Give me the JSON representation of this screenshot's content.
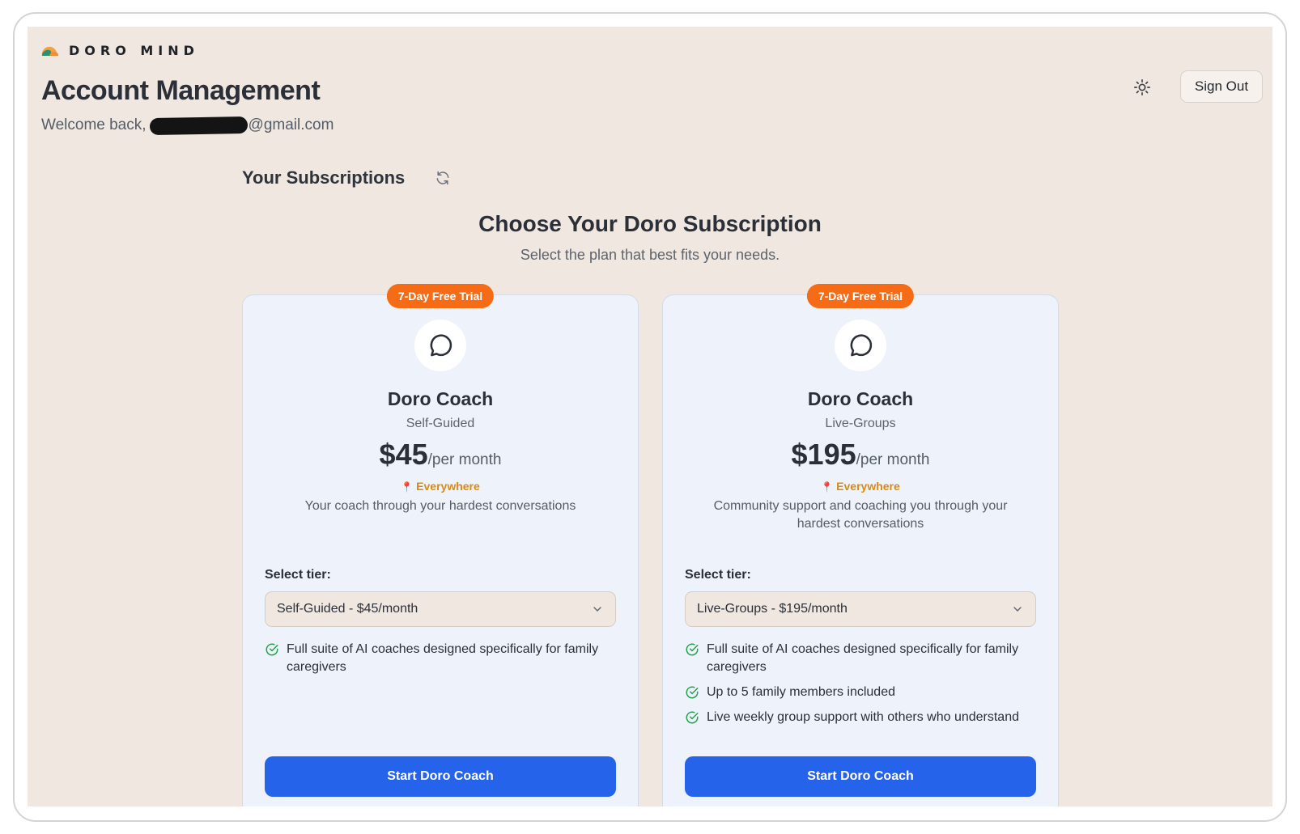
{
  "brand": {
    "logo_text": "DORO MIND"
  },
  "header": {
    "title": "Account Management",
    "welcome_prefix": "Welcome back, ",
    "email_suffix": "@gmail.com",
    "sign_out_label": "Sign Out"
  },
  "subscriptions": {
    "heading": "Your Subscriptions",
    "choose_title": "Choose Your Doro Subscription",
    "choose_subtitle": "Select the plan that best fits your needs."
  },
  "plans": [
    {
      "badge": "7-Day Free Trial",
      "name": "Doro Coach",
      "tier": "Self-Guided",
      "price": "$45",
      "period": "/per month",
      "location": "Everywhere",
      "description": "Your coach through your hardest conversations",
      "select_label": "Select tier:",
      "selected_option": "Self-Guided - $45/month",
      "features": [
        "Full suite of AI coaches designed specifically for family caregivers"
      ],
      "cta": "Start Doro Coach"
    },
    {
      "badge": "7-Day Free Trial",
      "name": "Doro Coach",
      "tier": "Live-Groups",
      "price": "$195",
      "period": "/per month",
      "location": "Everywhere",
      "description": "Community support and coaching you through your hardest conversations",
      "select_label": "Select tier:",
      "selected_option": "Live-Groups - $195/month",
      "features": [
        "Full suite of AI coaches designed specifically for family caregivers",
        "Up to 5 family members included",
        "Live weekly group support with others who understand"
      ],
      "cta": "Start Doro Coach"
    }
  ],
  "icons": {
    "logo": "doro-logo-icon",
    "theme": "sun-icon",
    "refresh": "refresh-icon",
    "plan": "chat-bubble-icon",
    "feature": "check-circle-icon",
    "select": "chevron-down-icon",
    "location": "pin-icon"
  },
  "colors": {
    "background": "#efe7e0",
    "card": "#eef3fb",
    "badge": "#f66b15",
    "primary": "#2563eb",
    "location": "#d98a12",
    "check": "#22a04b"
  }
}
